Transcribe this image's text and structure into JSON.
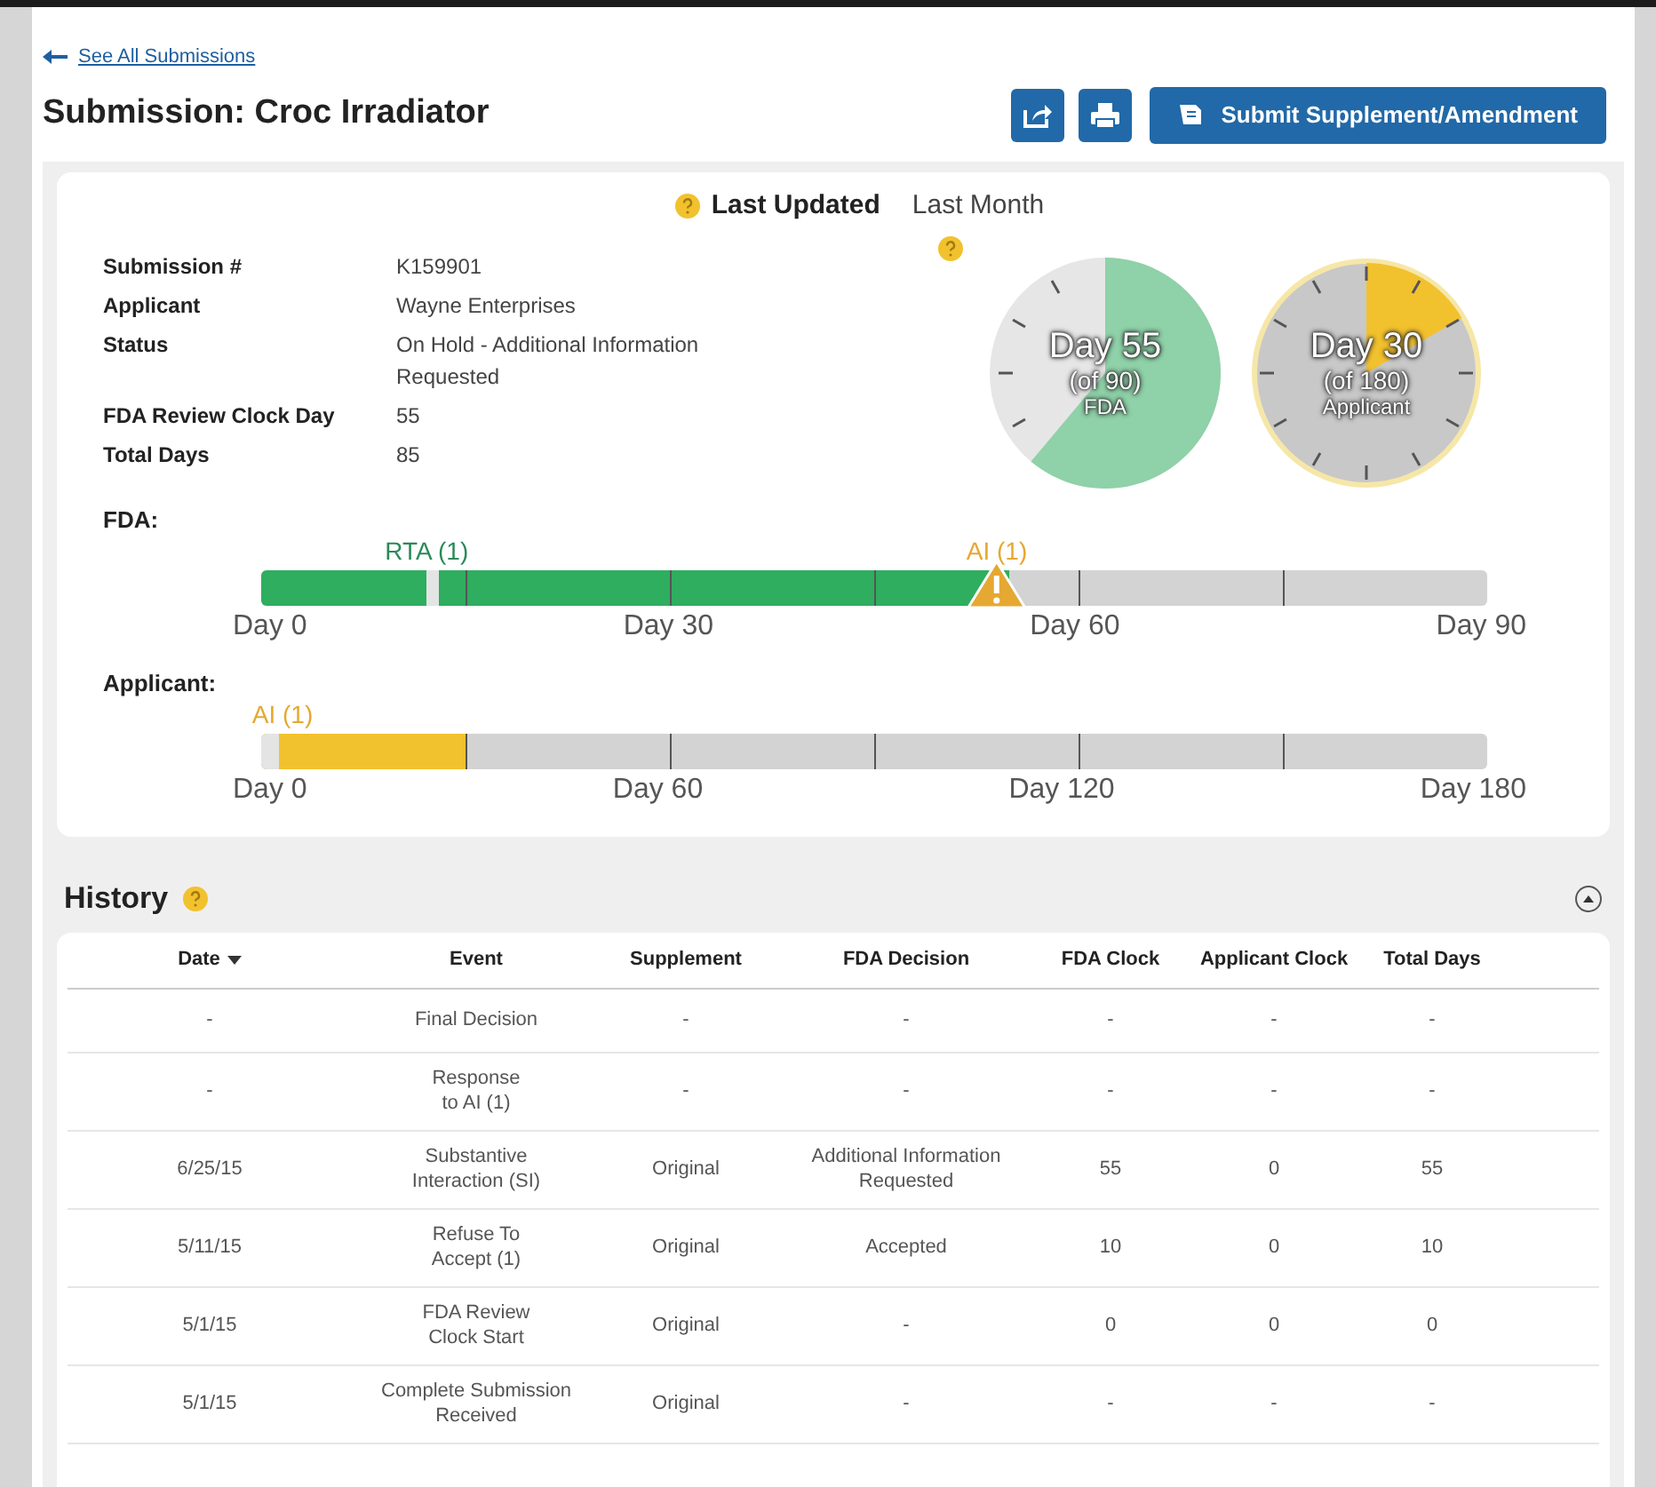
{
  "back_link": "See All Submissions",
  "title": "Submission: Croc Irradiator",
  "actions": [
    {
      "kind": "share"
    },
    {
      "kind": "print"
    },
    {
      "kind": "primary",
      "label": "Submit Supplement/Amendment"
    }
  ],
  "last_updated": {
    "label": "Last Updated",
    "value": "Last Month"
  },
  "details": [
    {
      "label": "Submission #",
      "value": "K159901"
    },
    {
      "label": "Applicant",
      "value": "Wayne Enterprises"
    },
    {
      "label": "Status",
      "value": "On Hold - Additional Information Requested"
    },
    {
      "label": "FDA Review Clock Day",
      "value": "55"
    },
    {
      "label": "Total Days",
      "value": "85"
    }
  ],
  "clocks": [
    {
      "kind": "pie",
      "title": "Day 55",
      "sub": "(of 90)",
      "caption": "FDA",
      "color": "#8fd1a8"
    },
    {
      "kind": "dial",
      "title": "Day 30",
      "sub": "(of 180)",
      "caption": "Applicant",
      "color": "#f2c12e"
    }
  ],
  "timelines": [
    {
      "label": "FDA:",
      "level": 0.61,
      "color": "#2eae5e",
      "tick_labels": [
        "Day 0",
        "Day 30",
        "Day 60",
        "Day 90"
      ],
      "markers": [
        {
          "kind": "notch",
          "label": "RTA (1)",
          "color": "#2a8a5a"
        },
        {
          "kind": "warning",
          "label": "AI (1)",
          "color": "#e5a832"
        }
      ]
    },
    {
      "label": "Applicant:",
      "level": 0.167,
      "color": "#f2c12e",
      "tick_labels": [
        "Day 0",
        "Day 60",
        "Day 120",
        "Day 180"
      ],
      "markers": [
        {
          "kind": "start",
          "label": "AI (1)",
          "color": "#e5a832"
        }
      ]
    }
  ],
  "history": {
    "title": "History",
    "expanded": true,
    "columns": [
      {
        "label": "Date",
        "sorted": true
      },
      {
        "label": "Event",
        "sorted": false
      },
      {
        "label": "Supplement",
        "sorted": false
      },
      {
        "label": "FDA Decision",
        "sorted": false
      },
      {
        "label": "FDA Clock",
        "sorted": false
      },
      {
        "label": "Applicant Clock",
        "sorted": false
      },
      {
        "label": "Total Days",
        "sorted": false
      }
    ],
    "rows": [
      [
        "-",
        "Final Decision",
        "-",
        "-",
        "-",
        "-",
        "-"
      ],
      [
        "-",
        "Response\nto AI (1)",
        "-",
        "-",
        "-",
        "-",
        "-"
      ],
      [
        "6/25/15",
        "Substantive\nInteraction (SI)",
        "Original",
        "Additional Information\nRequested",
        "55",
        "0",
        "55"
      ],
      [
        "5/11/15",
        "Refuse To\nAccept (1)",
        "Original",
        "Accepted",
        "10",
        "0",
        "10"
      ],
      [
        "5/1/15",
        "FDA Review\nClock Start",
        "Original",
        "-",
        "0",
        "0",
        "0"
      ],
      [
        "5/1/15",
        "Complete Submission\nReceived",
        "Original",
        "-",
        "-",
        "-",
        "-"
      ]
    ]
  }
}
